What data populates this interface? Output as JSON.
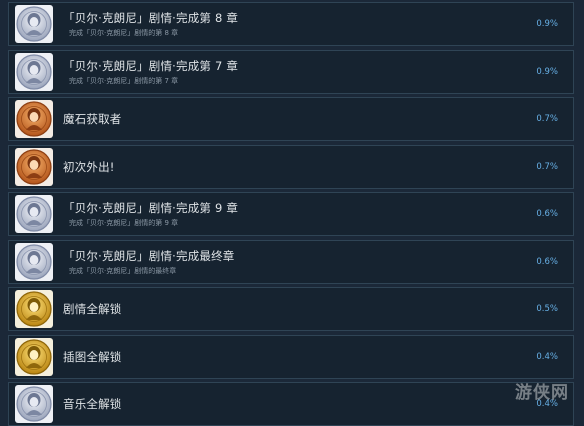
{
  "achievements": [
    {
      "title": "「贝尔·克朗尼」剧情·完成第 8 章",
      "desc": "完成「贝尔·克朗尼」剧情的第 8 章",
      "percent": "0.9%",
      "icon": "silver-character-badge-icon"
    },
    {
      "title": "「贝尔·克朗尼」剧情·完成第 7 章",
      "desc": "完成「贝尔·克朗尼」剧情的第 7 章",
      "percent": "0.9%",
      "icon": "silver-character-badge-icon"
    },
    {
      "title": "魔石获取者",
      "desc": "",
      "percent": "0.7%",
      "icon": "bronze-character-badge-icon"
    },
    {
      "title": "初次外出!",
      "desc": "",
      "percent": "0.7%",
      "icon": "bronze-character-badge-icon"
    },
    {
      "title": "「贝尔·克朗尼」剧情·完成第 9 章",
      "desc": "完成「贝尔·克朗尼」剧情的第 9 章",
      "percent": "0.6%",
      "icon": "silver-character-badge-icon"
    },
    {
      "title": "「贝尔·克朗尼」剧情·完成最终章",
      "desc": "完成「贝尔·克朗尼」剧情的最终章",
      "percent": "0.6%",
      "icon": "silver-character-badge-icon"
    },
    {
      "title": "剧情全解锁",
      "desc": "",
      "percent": "0.5%",
      "icon": "gold-character-badge-icon"
    },
    {
      "title": "插图全解锁",
      "desc": "",
      "percent": "0.4%",
      "icon": "gold-character-badge-icon"
    },
    {
      "title": "音乐全解锁",
      "desc": "",
      "percent": "0.4%",
      "icon": "silver-character-badge-icon"
    }
  ],
  "watermark": {
    "text": "游侠网"
  },
  "colors": {
    "background": "#1b2838",
    "row": "#162330",
    "border": "#2f4455",
    "percent": "#67b0e6",
    "silver": "#c8cedc",
    "bronze": "#d9822b",
    "gold": "#e3b41f"
  }
}
